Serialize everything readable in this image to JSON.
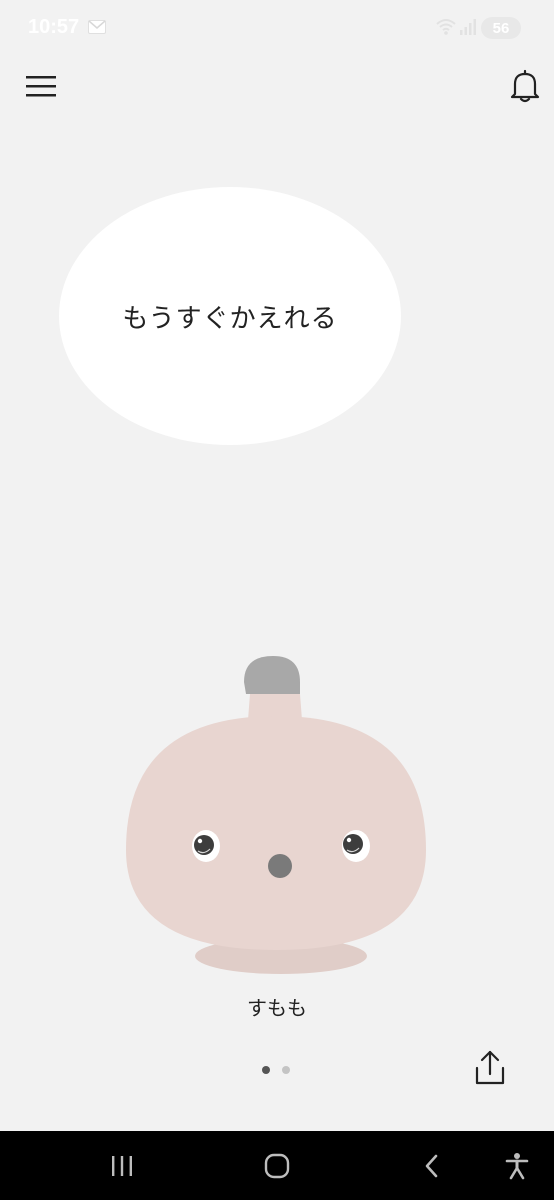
{
  "status_bar": {
    "time": "10:57",
    "battery_level": "56",
    "icons": [
      "mail-icon",
      "wifi-icon",
      "signal-icon",
      "battery-icon"
    ]
  },
  "header": {
    "menu_icon": "hamburger-menu-icon",
    "notification_icon": "bell-icon"
  },
  "speech_bubble": {
    "text": "もうすぐかえれる"
  },
  "robot": {
    "name": "すもも",
    "body_color": "#e8d5d0",
    "antenna_color": "#a8a8a8"
  },
  "pager": {
    "total": 2,
    "active_index": 0
  },
  "share": {
    "icon": "share-icon"
  },
  "nav_bar": {
    "icons": [
      "recent-apps-icon",
      "home-icon",
      "back-icon",
      "accessibility-icon"
    ]
  }
}
